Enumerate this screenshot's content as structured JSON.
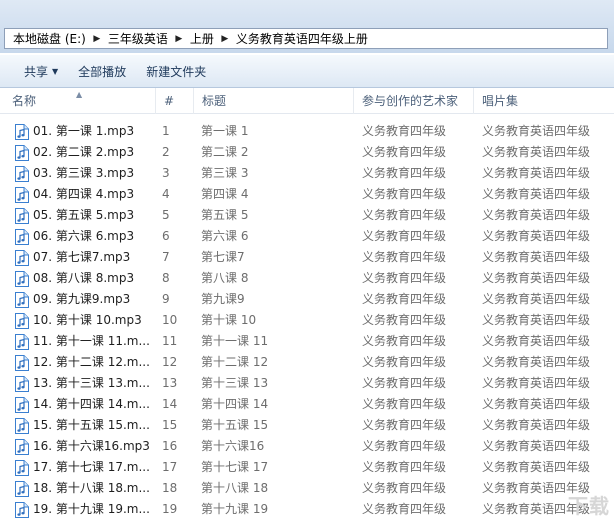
{
  "breadcrumb": [
    "本地磁盘 (E:)",
    "三年级英语",
    "上册",
    "义务教育英语四年级上册"
  ],
  "toolbar": {
    "share": "共享",
    "play_all": "全部播放",
    "new_folder": "新建文件夹"
  },
  "columns": {
    "name": "名称",
    "number": "#",
    "title": "标题",
    "artist": "参与创作的艺术家",
    "album": "唱片集"
  },
  "files": [
    {
      "name": "01. 第一课 1.mp3",
      "number": "1",
      "title": "第一课 1",
      "artist": "义务教育四年级",
      "album": "义务教育英语四年级"
    },
    {
      "name": "02. 第二课 2.mp3",
      "number": "2",
      "title": "第二课 2",
      "artist": "义务教育四年级",
      "album": "义务教育英语四年级"
    },
    {
      "name": "03. 第三课 3.mp3",
      "number": "3",
      "title": "第三课 3",
      "artist": "义务教育四年级",
      "album": "义务教育英语四年级"
    },
    {
      "name": "04. 第四课 4.mp3",
      "number": "4",
      "title": "第四课 4",
      "artist": "义务教育四年级",
      "album": "义务教育英语四年级"
    },
    {
      "name": "05. 第五课 5.mp3",
      "number": "5",
      "title": "第五课 5",
      "artist": "义务教育四年级",
      "album": "义务教育英语四年级"
    },
    {
      "name": "06. 第六课 6.mp3",
      "number": "6",
      "title": "第六课 6",
      "artist": "义务教育四年级",
      "album": "义务教育英语四年级"
    },
    {
      "name": "07. 第七课7.mp3",
      "number": "7",
      "title": "第七课7",
      "artist": "义务教育四年级",
      "album": "义务教育英语四年级"
    },
    {
      "name": "08. 第八课 8.mp3",
      "number": "8",
      "title": "第八课 8",
      "artist": "义务教育四年级",
      "album": "义务教育英语四年级"
    },
    {
      "name": "09. 第九课9.mp3",
      "number": "9",
      "title": "第九课9",
      "artist": "义务教育四年级",
      "album": "义务教育英语四年级"
    },
    {
      "name": "10. 第十课 10.mp3",
      "number": "10",
      "title": "第十课 10",
      "artist": "义务教育四年级",
      "album": "义务教育英语四年级"
    },
    {
      "name": "11. 第十一课 11.m...",
      "number": "11",
      "title": "第十一课 11",
      "artist": "义务教育四年级",
      "album": "义务教育英语四年级"
    },
    {
      "name": "12. 第十二课 12.m...",
      "number": "12",
      "title": "第十二课 12",
      "artist": "义务教育四年级",
      "album": "义务教育英语四年级"
    },
    {
      "name": "13. 第十三课 13.m...",
      "number": "13",
      "title": "第十三课 13",
      "artist": "义务教育四年级",
      "album": "义务教育英语四年级"
    },
    {
      "name": "14. 第十四课 14.m...",
      "number": "14",
      "title": "第十四课 14",
      "artist": "义务教育四年级",
      "album": "义务教育英语四年级"
    },
    {
      "name": "15. 第十五课 15.m...",
      "number": "15",
      "title": "第十五课 15",
      "artist": "义务教育四年级",
      "album": "义务教育英语四年级"
    },
    {
      "name": "16. 第十六课16.mp3",
      "number": "16",
      "title": "第十六课16",
      "artist": "义务教育四年级",
      "album": "义务教育英语四年级"
    },
    {
      "name": "17. 第十七课 17.m...",
      "number": "17",
      "title": "第十七课 17",
      "artist": "义务教育四年级",
      "album": "义务教育英语四年级"
    },
    {
      "name": "18. 第十八课 18.m...",
      "number": "18",
      "title": "第十八课 18",
      "artist": "义务教育四年级",
      "album": "义务教育英语四年级"
    },
    {
      "name": "19. 第十九课 19.m...",
      "number": "19",
      "title": "第十九课 19",
      "artist": "义务教育四年级",
      "album": "义务教育英语四年级"
    }
  ],
  "icons": {
    "file": "music-file-icon",
    "share_dropdown": "chevron-down-icon",
    "sort": "sort-up-icon",
    "breadcrumb_sep": "chevron-right-icon"
  },
  "colors": {
    "accent": "#2a6fc9",
    "header_text": "#4c607a",
    "toolbar_text": "#1e395b"
  }
}
